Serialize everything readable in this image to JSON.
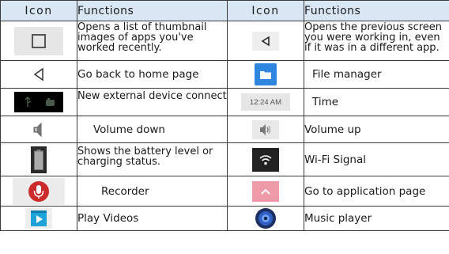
{
  "header": {
    "icon_col_1": "Icon",
    "functions_col_1": "Functions",
    "icon_col_2": "Icon",
    "functions_col_2": "Functions"
  },
  "rows": [
    {
      "left_icon": "recent-apps-icon",
      "left_text": "Opens a list of thumbnail images of apps you've worked recently.",
      "right_icon": "back-triangle-icon",
      "right_text": "Opens the previous screen you were working in, even if it was in a different app."
    },
    {
      "left_icon": "home-back-triangle-icon",
      "left_text": "Go back to home page",
      "right_icon": "file-manager-icon",
      "right_text": "File manager"
    },
    {
      "left_icon": "external-device-icon",
      "left_text": "New external device connect",
      "right_icon": "clock-text-icon",
      "right_text": "Time",
      "right_icon_text": "12:24 AM"
    },
    {
      "left_icon": "volume-down-icon",
      "left_text": "Volume down",
      "right_icon": "volume-up-icon",
      "right_text": "Volume up"
    },
    {
      "left_icon": "battery-icon",
      "left_text": "Shows the battery level or charging status.",
      "right_icon": "wifi-signal-icon",
      "right_text": "Wi-Fi Signal"
    },
    {
      "left_icon": "microphone-icon",
      "left_text": "Recorder",
      "right_icon": "chevron-up-icon",
      "right_text": "Go to application page"
    },
    {
      "left_icon": "play-videos-icon",
      "left_text": "Play Videos",
      "right_icon": "music-player-icon",
      "right_text": "Music player"
    }
  ],
  "colors": {
    "header_bg": "#d9e7f4",
    "tile_bg": "#e6e6e6",
    "blue_accent": "#2f86e0",
    "mic_red": "#cc2b2b",
    "pink_tile": "#ef9aa8"
  }
}
